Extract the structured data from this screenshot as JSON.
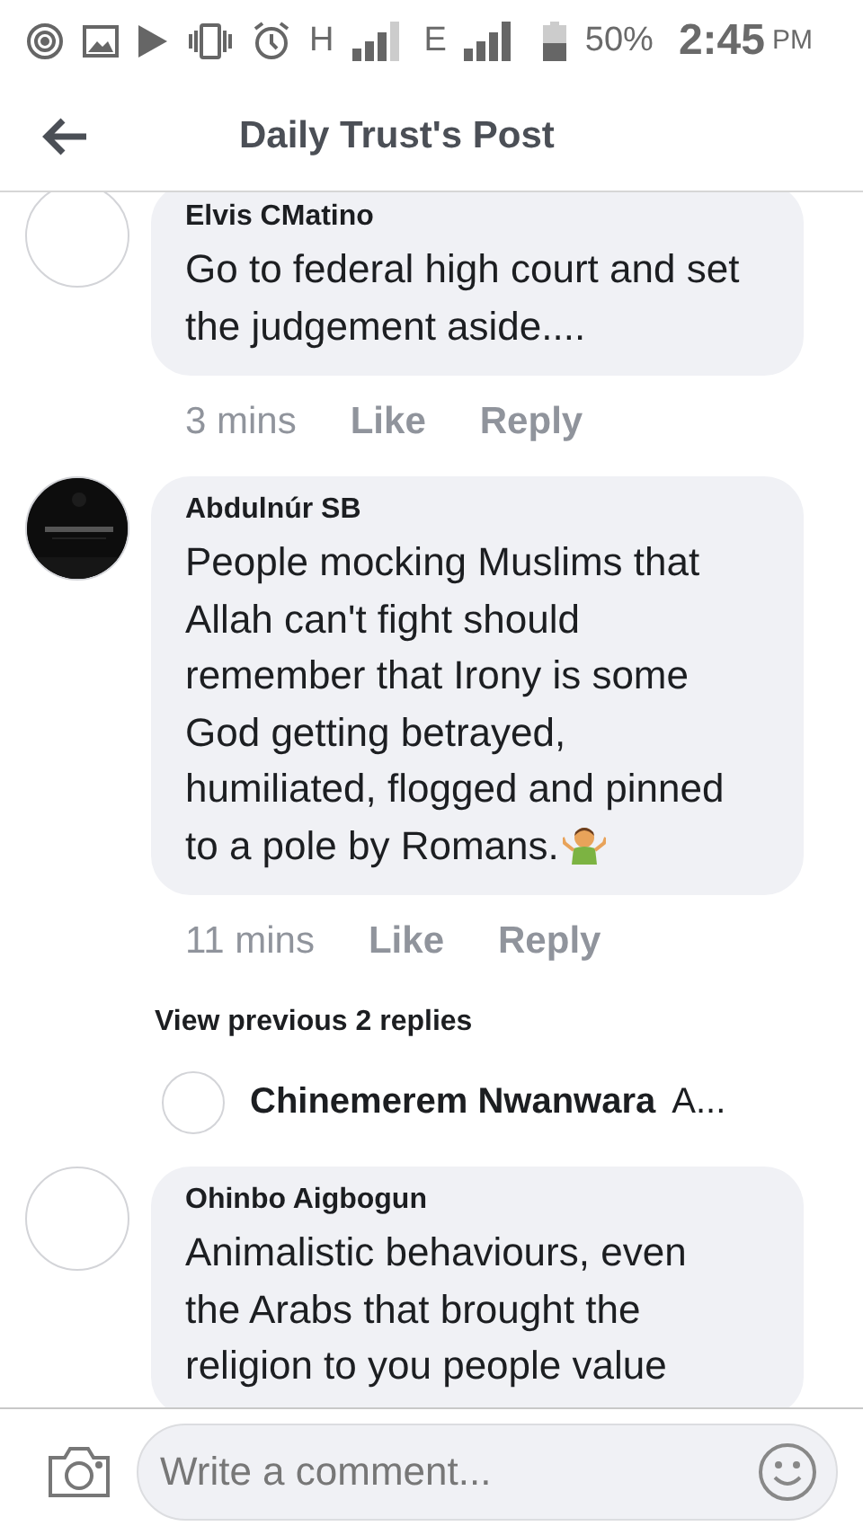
{
  "status_bar": {
    "network_1": "H",
    "network_2": "E",
    "battery": "50%",
    "time": "2:45",
    "meridiem": "PM"
  },
  "header": {
    "title": "Daily Trust's Post"
  },
  "items": [
    {
      "kind": "comment",
      "author": "Elvis CMatino",
      "text": "Go to federal high court and set the judgement aside....",
      "emoji": false,
      "time": "3 mins",
      "actions": [
        "Like",
        "Reply"
      ]
    },
    {
      "kind": "comment",
      "author": "Abdulnúr SB",
      "text": "People mocking Muslims that Allah can't fight should remember that Irony is some God getting betrayed, humiliated, flogged and pinned to a pole by Romans.",
      "emoji": true,
      "time": "11 mins",
      "actions": [
        "Like",
        "Reply"
      ]
    },
    {
      "kind": "more",
      "label": "View previous 2 replies"
    },
    {
      "kind": "reply",
      "author": "Chinemerem Nwanwara",
      "text": "A..."
    },
    {
      "kind": "comment",
      "author": "Ohinbo Aigbogun",
      "text": "Animalistic behaviours, even the Arabs that brought the religion to you people value",
      "emoji": false
    }
  ],
  "composer": {
    "placeholder": "Write a comment..."
  }
}
